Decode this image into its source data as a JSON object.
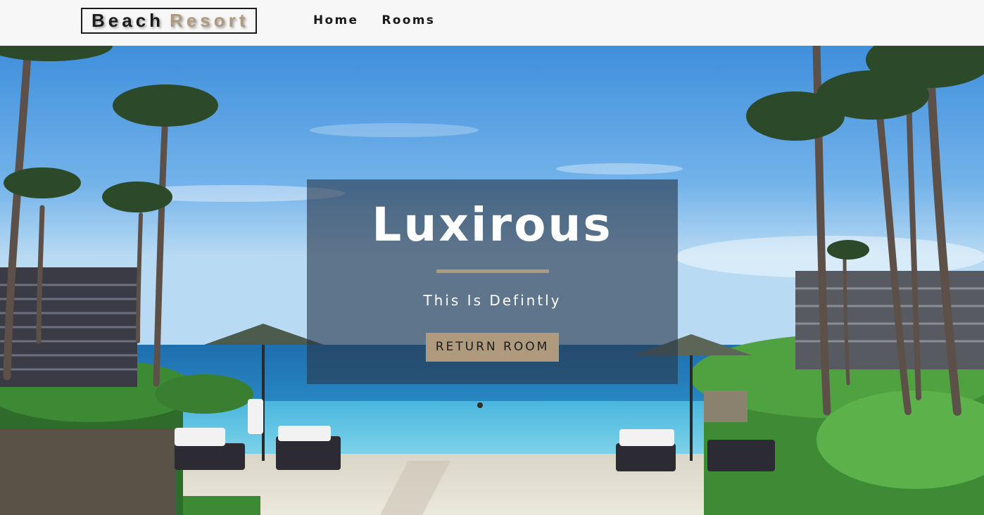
{
  "navbar": {
    "logo_word1": "Beach",
    "logo_word2": "Resort",
    "links": [
      {
        "label": "Home"
      },
      {
        "label": "Rooms"
      }
    ]
  },
  "hero": {
    "title": "Luxirous",
    "subtitle": "This Is Defintly",
    "button_label": "RETURN ROOM"
  },
  "colors": {
    "accent": "#af9a7d",
    "navbar_bg": "#f7f7f7",
    "text_dark": "#1c1c1c",
    "banner_overlay": "rgba(40, 55, 75, 0.62)"
  }
}
